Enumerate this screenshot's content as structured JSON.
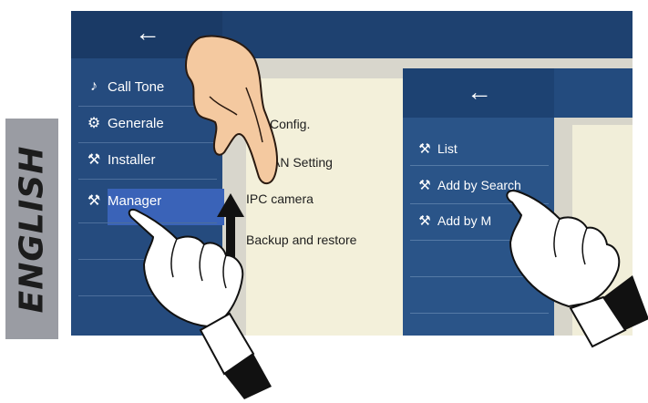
{
  "language_tab": {
    "label": "ENGLISH"
  },
  "screen1": {
    "back_icon": "←",
    "menu": [
      {
        "icon": "♪",
        "label": "Call Tone"
      },
      {
        "icon": "⚙",
        "label": "Generale"
      },
      {
        "icon": "⚒",
        "label": "Installer"
      },
      {
        "icon": "⚒",
        "label": "Manager"
      }
    ],
    "submenu": [
      {
        "label": "Config."
      },
      {
        "label": "AN Setting"
      },
      {
        "label": "IPC camera"
      },
      {
        "label": "Backup and restore"
      }
    ]
  },
  "screen2": {
    "back_icon": "←",
    "menu": [
      {
        "icon": "⚒",
        "label": "List"
      },
      {
        "icon": "⚒",
        "label": "Add by Search"
      },
      {
        "icon": "⚒",
        "label": "Add by M"
      }
    ]
  },
  "colors": {
    "accent": "#3a63b8",
    "screen_bg": "#274b7a"
  }
}
